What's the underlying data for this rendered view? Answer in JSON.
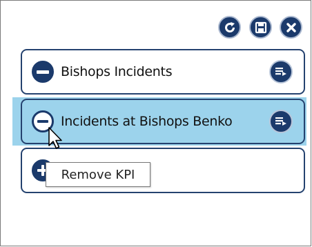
{
  "toolbar": {
    "refresh_icon": "refresh-icon",
    "save_icon": "save-icon",
    "close_icon": "close-icon"
  },
  "kpis": [
    {
      "label": "Bishops Incidents"
    },
    {
      "label": "Incidents at Bishops Benko"
    }
  ],
  "tooltip": {
    "text": "Remove KPI"
  },
  "colors": {
    "accent": "#1b3a6b",
    "highlight": "#9cd3ec",
    "border": "#24426f"
  }
}
